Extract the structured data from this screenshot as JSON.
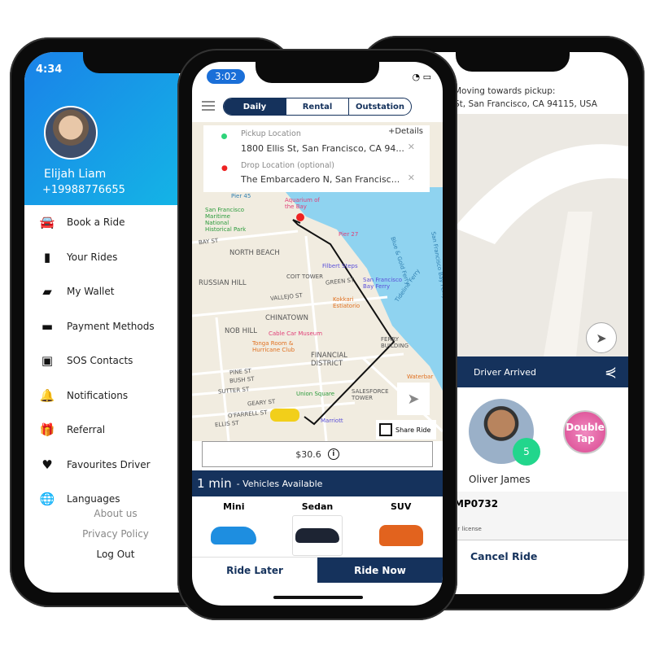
{
  "left_phone": {
    "time": "4:34",
    "user": {
      "name": "Elijah Liam",
      "phone": "+19988776655"
    },
    "menu": [
      {
        "label": "Book a Ride",
        "icon": "car-icon"
      },
      {
        "label": "Your Rides",
        "icon": "bookmark-icon"
      },
      {
        "label": "My Wallet",
        "icon": "wallet-icon"
      },
      {
        "label": "Payment Methods",
        "icon": "credit-card-icon"
      },
      {
        "label": "SOS Contacts",
        "icon": "contacts-icon"
      },
      {
        "label": "Notifications",
        "icon": "bell-icon"
      },
      {
        "label": "Referral",
        "icon": "gift-icon"
      },
      {
        "label": "Favourites Driver",
        "icon": "heart-icon"
      },
      {
        "label": "Languages",
        "icon": "globe-icon"
      }
    ],
    "footer": {
      "about": "About us",
      "privacy": "Privacy Policy",
      "logout": "Log Out"
    },
    "header_color": "#1a82e8"
  },
  "center_phone": {
    "time": "3:02",
    "tabs": [
      {
        "label": "Daily",
        "active": true
      },
      {
        "label": "Rental"
      },
      {
        "label": "Outstation"
      }
    ],
    "pickup": {
      "label": "Pickup Location",
      "value": "1800 Ellis St, San Francisco, CA 94..."
    },
    "drop": {
      "label": "Drop Location (optional)",
      "value": "The Embarcadero N, San Francisc..."
    },
    "details_link": "+Details",
    "map_labels": [
      "Pier 45",
      "Aquarium of the Bay",
      "San Francisco Maritime National Historical Park",
      "BAY ST",
      "Pier 27",
      "NORTH BEACH",
      "Filbert Steps",
      "COIT TOWER",
      "RUSSIAN HILL",
      "GREEN ST",
      "San Francisco Bay Ferry",
      "VALLEJO ST",
      "Kokkari Estiatorio",
      "CHINATOWN",
      "NOB HILL",
      "Cable Car Museum",
      "Tonga Room & Hurricane Club",
      "FINANCIAL DISTRICT",
      "FERRY BUILDING",
      "PINE ST",
      "BUSH ST",
      "SUTTER ST",
      "Union Square",
      "GEARY ST",
      "O'FARRELL ST",
      "ELLIS ST",
      "Marriott",
      "SALESFORCE TOWER",
      "Waterbar",
      "Blue & Gold Ferry",
      "San Francisco Bay Ferry",
      "Tideline Ferry"
    ],
    "share_ride": "Share Ride",
    "fare": "$30.6",
    "eta": "1 min",
    "eta_suffix": "- Vehicles Available",
    "vehicles": [
      {
        "name": "Mini",
        "color": "#1e8ee0"
      },
      {
        "name": "Sedan",
        "color": "#1d2433",
        "selected": true
      },
      {
        "name": "SUV",
        "color": "#e2631e"
      }
    ],
    "ride_later": "Ride Later",
    "ride_now": "Ride Now",
    "accent": "#15325c"
  },
  "right_phone": {
    "status_title": "Moving towards pickup:",
    "status_address": "St, San Francisco, CA 94115, USA",
    "bar_label": "Driver Arrived",
    "driver": {
      "name": "Oliver James",
      "rating": "5"
    },
    "double_tap": "Double Tap",
    "plate": "MP0732",
    "license_label": "er license",
    "cancel": "Cancel Ride"
  }
}
